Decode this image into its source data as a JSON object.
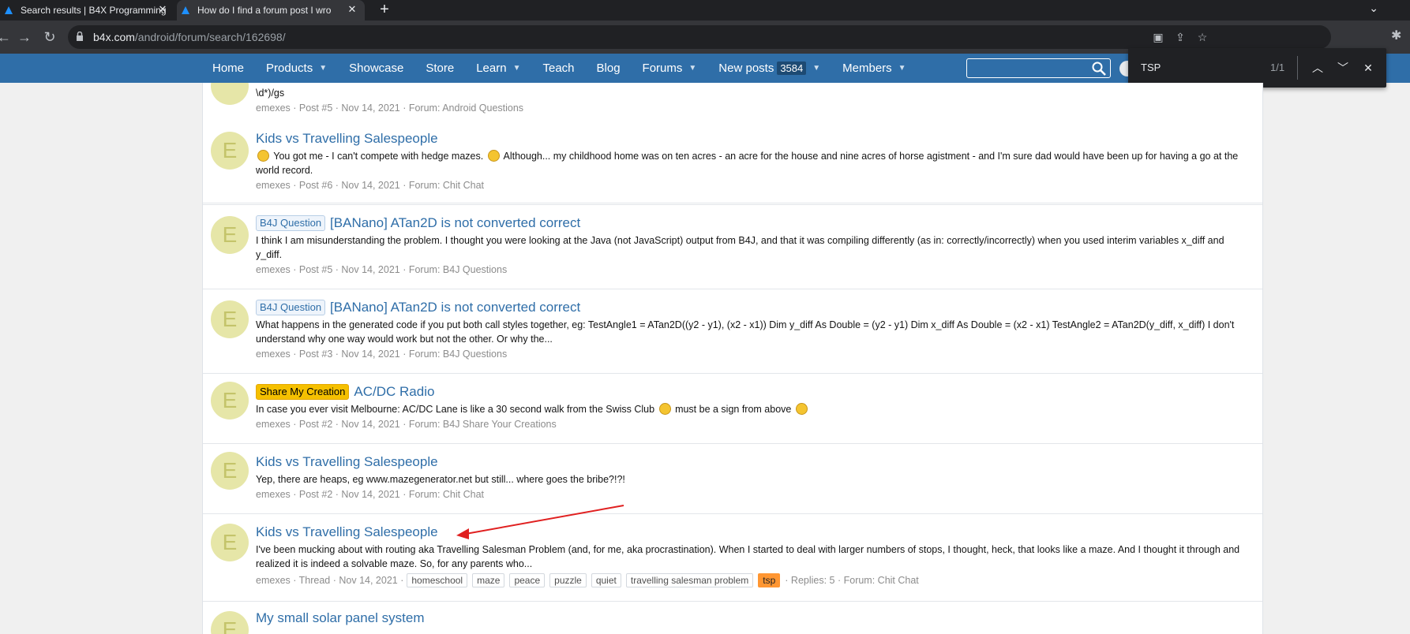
{
  "browser": {
    "tabs": [
      {
        "label": "Search results | B4X Programming",
        "active": false
      },
      {
        "label": "How do I find a forum post I wro",
        "active": true
      }
    ],
    "url_host": "b4x.com",
    "url_path": "/android/forum/search/162698/"
  },
  "find_bar": {
    "query": "TSP",
    "count": "1/1"
  },
  "site_nav": {
    "items": [
      {
        "label": "Home",
        "caret": false
      },
      {
        "label": "Products",
        "caret": true
      },
      {
        "label": "Showcase",
        "caret": false
      },
      {
        "label": "Store",
        "caret": false
      },
      {
        "label": "Learn",
        "caret": true
      },
      {
        "label": "Teach",
        "caret": false
      },
      {
        "label": "Blog",
        "caret": false
      },
      {
        "label": "Forums",
        "caret": true
      },
      {
        "label": "New posts",
        "caret": true,
        "badge": "3584"
      },
      {
        "label": "Members",
        "caret": true
      }
    ]
  },
  "results": [
    {
      "avatar_letter": "",
      "title": "",
      "snippet": "\\d*)/gs",
      "meta": "emexes · Post #5 · Nov 14, 2021 · Forum: Android Questions"
    },
    {
      "avatar_letter": "E",
      "title": "Kids vs Travelling Salespeople",
      "snippet_a": "You got me - I can't compete with hedge mazes.",
      "snippet_b": "Although... my childhood home was on ten acres - an acre for the house and nine acres of horse agistment - and I'm sure dad would have been up for having a go at the world record.",
      "meta": "emexes · Post #6 · Nov 14, 2021 · Forum: Chit Chat"
    },
    {
      "avatar_letter": "E",
      "prefix": "B4J Question",
      "title": "[BANano] ATan2D is not converted correct",
      "snippet": "I think I am misunderstanding the problem. I thought you were looking at the Java (not JavaScript) output from B4J, and that it was compiling differently (as in: correctly/incorrectly) when you used interim variables x_diff and y_diff.",
      "meta": "emexes · Post #5 · Nov 14, 2021 · Forum: B4J Questions"
    },
    {
      "avatar_letter": "E",
      "prefix": "B4J Question",
      "title": "[BANano] ATan2D is not converted correct",
      "snippet": "What happens in the generated code if you put both call styles together, eg: TestAngle1 = ATan2D((y2 - y1), (x2 - x1)) Dim y_diff As Double = (y2 - y1) Dim x_diff As Double = (x2 - x1) TestAngle2 = ATan2D(y_diff, x_diff) I don't understand why one way would work but not the other. Or why the...",
      "meta": "emexes · Post #3 · Nov 14, 2021 · Forum: B4J Questions"
    },
    {
      "avatar_letter": "E",
      "prefix": "Share My Creation",
      "title": "AC/DC Radio",
      "snippet_a": "In case you ever visit Melbourne: AC/DC Lane is like a 30 second walk from the Swiss Club",
      "snippet_b": "must be a sign from above",
      "meta": "emexes · Post #2 · Nov 14, 2021 · Forum: B4J Share Your Creations"
    },
    {
      "avatar_letter": "E",
      "title": "Kids vs Travelling Salespeople",
      "snippet": "Yep, there are heaps, eg www.mazegenerator.net but still... where goes the bribe?!?!",
      "meta": "emexes · Post #2 · Nov 14, 2021 · Forum: Chit Chat"
    },
    {
      "avatar_letter": "E",
      "title": "Kids vs Travelling Salespeople",
      "snippet": "I've been mucking about with routing aka Travelling Salesman Problem (and, for me, aka procrastination). When I started to deal with larger numbers of stops, I thought, heck, that looks like a maze. And I thought it through and realized it is indeed a solvable maze. So, for any parents who...",
      "meta_prefix": "emexes · Thread · Nov 14, 2021 ·",
      "tags": [
        "homeschool",
        "maze",
        "peace",
        "puzzle",
        "quiet",
        "travelling salesman problem",
        "tsp"
      ],
      "meta_suffix": "· Replies: 5 · Forum: Chit Chat"
    },
    {
      "avatar_letter": "E",
      "title": "My small solar panel system"
    }
  ],
  "colors": {
    "nav_blue": "#2f6ea8",
    "link_blue": "#2f6ea8",
    "avatar_bg": "#e6e6a8",
    "annotation_arrow": "#e02020",
    "find_highlight": "#ff9632"
  }
}
